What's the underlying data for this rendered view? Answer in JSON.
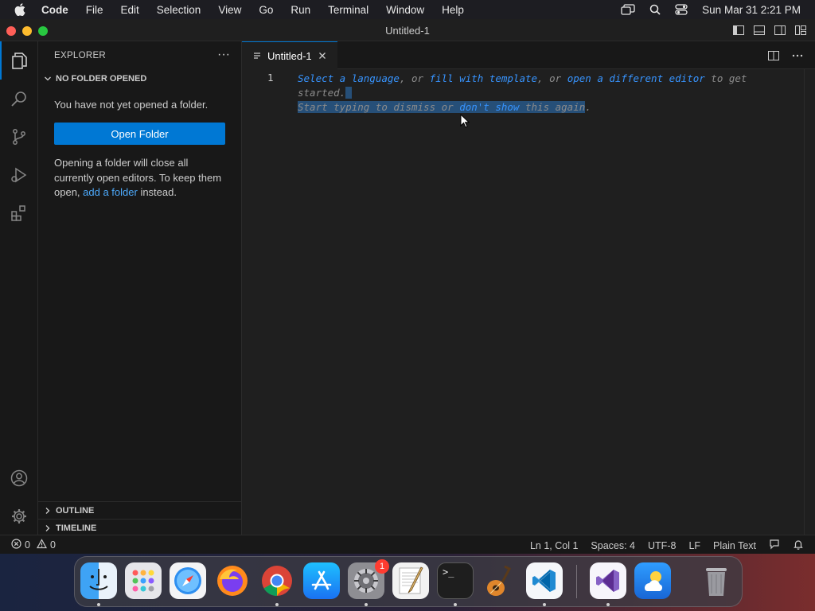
{
  "menubar": {
    "items": [
      "Code",
      "File",
      "Edit",
      "Selection",
      "View",
      "Go",
      "Run",
      "Terminal",
      "Window",
      "Help"
    ],
    "clock": "Sun Mar 31  2:21 PM"
  },
  "window": {
    "title": "Untitled-1"
  },
  "sidebar": {
    "title": "EXPLORER",
    "more": "···",
    "section": "NO FOLDER OPENED",
    "message": "You have not yet opened a folder.",
    "open_button": "Open Folder",
    "desc_before": "Opening a folder will close all currently open editors. To keep them open, ",
    "desc_link": "add a folder",
    "desc_after": " instead.",
    "outline": "OUTLINE",
    "timeline": "TIMELINE"
  },
  "tab": {
    "label": "Untitled-1"
  },
  "editor": {
    "line_number": "1",
    "hint": {
      "l1_link1": "Select a language",
      "l1_t1": ", or ",
      "l1_link2": "fill with template",
      "l1_t2": ", or ",
      "l1_link3": "open a different editor",
      "l1_t3": " to get",
      "l2": "started.",
      "l3_t1": "Start typing to dismiss or ",
      "l3_link": "don't show",
      "l3_t2": " this again",
      "l3_end": "."
    }
  },
  "status": {
    "errors": "0",
    "warnings": "0",
    "position": "Ln 1, Col 1",
    "spaces": "Spaces: 4",
    "encoding": "UTF-8",
    "eol": "LF",
    "language": "Plain Text"
  },
  "dock": {
    "apps": [
      "finder",
      "launchpad",
      "safari",
      "firefox",
      "chrome",
      "app-store",
      "system-settings",
      "textedit",
      "terminal",
      "garageband",
      "vscode",
      "visual-studio",
      "weather",
      "trash"
    ],
    "settings_badge": "1",
    "terminal_prompt": ">_"
  }
}
